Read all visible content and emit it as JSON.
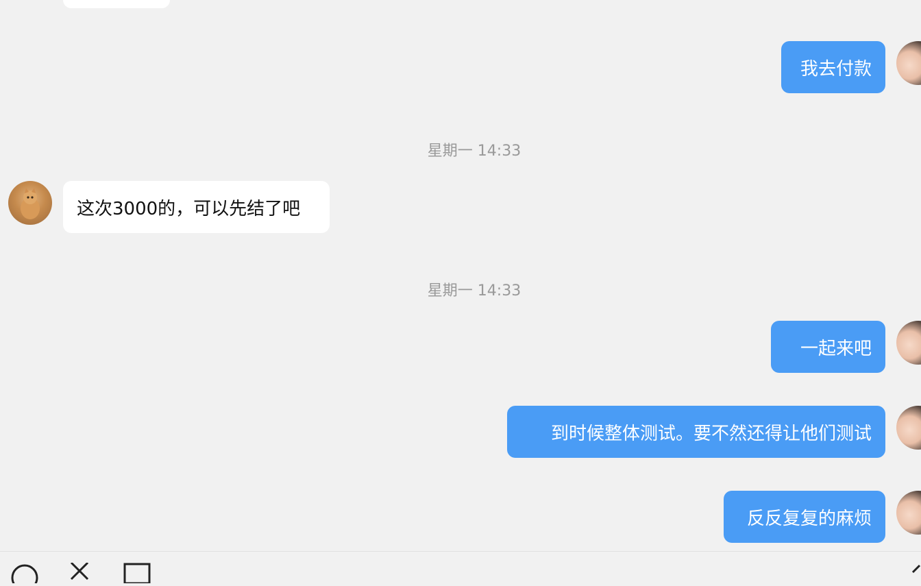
{
  "messages": [
    {
      "type": "incoming",
      "text": ""
    },
    {
      "type": "outgoing",
      "text": "我去付款"
    },
    {
      "type": "timestamp",
      "text": "星期一 14:33"
    },
    {
      "type": "incoming",
      "text": "这次3000的，可以先结了吧"
    },
    {
      "type": "timestamp",
      "text": "星期一 14:33"
    },
    {
      "type": "outgoing",
      "text": "一起来吧"
    },
    {
      "type": "outgoing",
      "text": "到时候整体测试。要不然还得让他们测试"
    },
    {
      "type": "outgoing",
      "text": "反反复复的麻烦"
    }
  ],
  "avatars": {
    "contact": "cat-avatar",
    "self": "woman-avatar"
  },
  "composer": {
    "icons": [
      "emoji-icon",
      "scissors-icon",
      "folder-icon",
      "send-icon"
    ]
  },
  "colors": {
    "background": "#f1f1f1",
    "outgoing_bubble": "#4a9cf5",
    "incoming_bubble": "#ffffff",
    "timestamp_text": "#999999"
  }
}
